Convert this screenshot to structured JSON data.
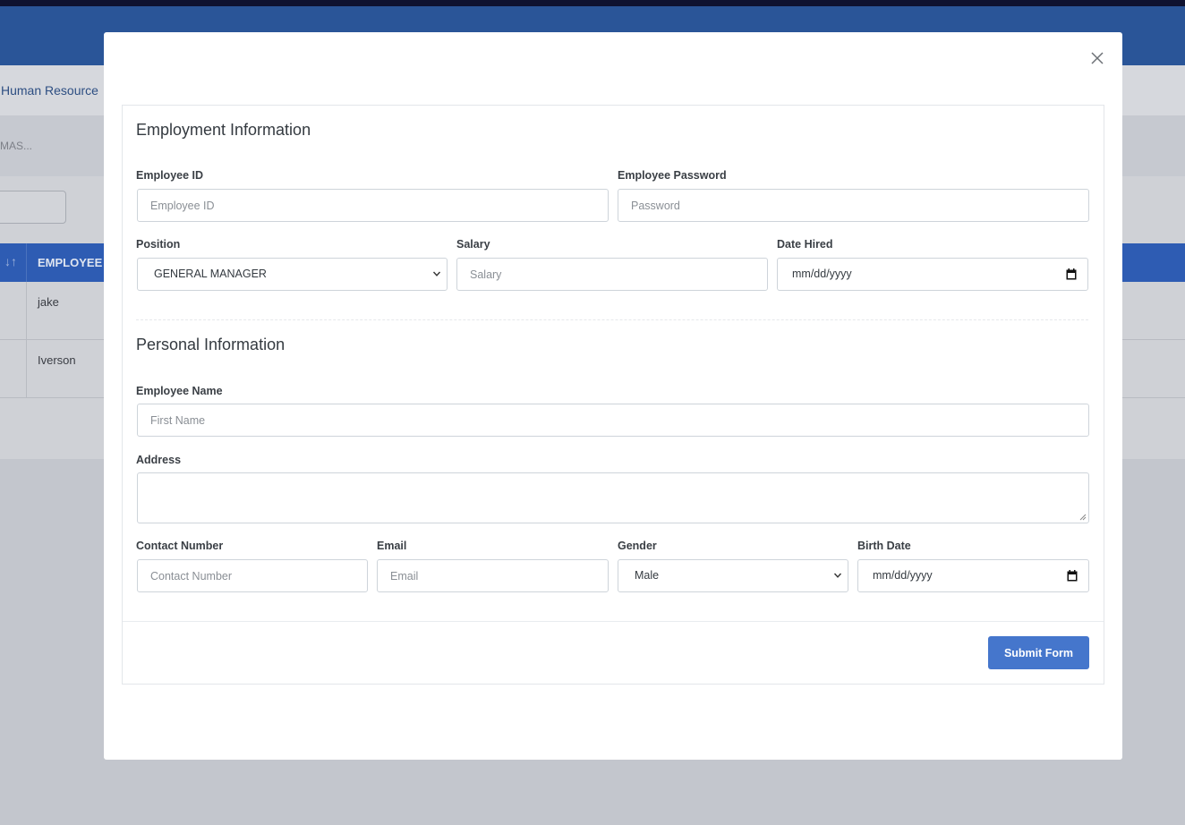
{
  "background": {
    "breadcrumb": "Human Resource",
    "subtitle": "MAS...",
    "table": {
      "header_name": "EMPLOYEE N",
      "rows": [
        {
          "name": "jake"
        },
        {
          "name": "Iverson"
        }
      ]
    }
  },
  "modal": {
    "employment": {
      "title": "Employment Information",
      "employee_id": {
        "label": "Employee ID",
        "placeholder": "Employee ID"
      },
      "employee_password": {
        "label": "Employee Password",
        "placeholder": "Password"
      },
      "position": {
        "label": "Position",
        "value": "GENERAL MANAGER"
      },
      "salary": {
        "label": "Salary",
        "placeholder": "Salary"
      },
      "date_hired": {
        "label": "Date Hired",
        "value": "mm/dd/yyyy"
      }
    },
    "personal": {
      "title": "Personal Information",
      "employee_name": {
        "label": "Employee Name",
        "placeholder": "First Name"
      },
      "address": {
        "label": "Address"
      },
      "contact_number": {
        "label": "Contact Number",
        "placeholder": "Contact Number"
      },
      "email": {
        "label": "Email",
        "placeholder": "Email"
      },
      "gender": {
        "label": "Gender",
        "value": "Male"
      },
      "birth_date": {
        "label": "Birth Date",
        "value": "mm/dd/yyyy"
      }
    },
    "submit_label": "Submit Form"
  },
  "colors": {
    "header": "#2a5598",
    "table_header": "#2e5cb3",
    "submit_button": "#4576cc",
    "overlay_background": "#c3c6cd"
  }
}
